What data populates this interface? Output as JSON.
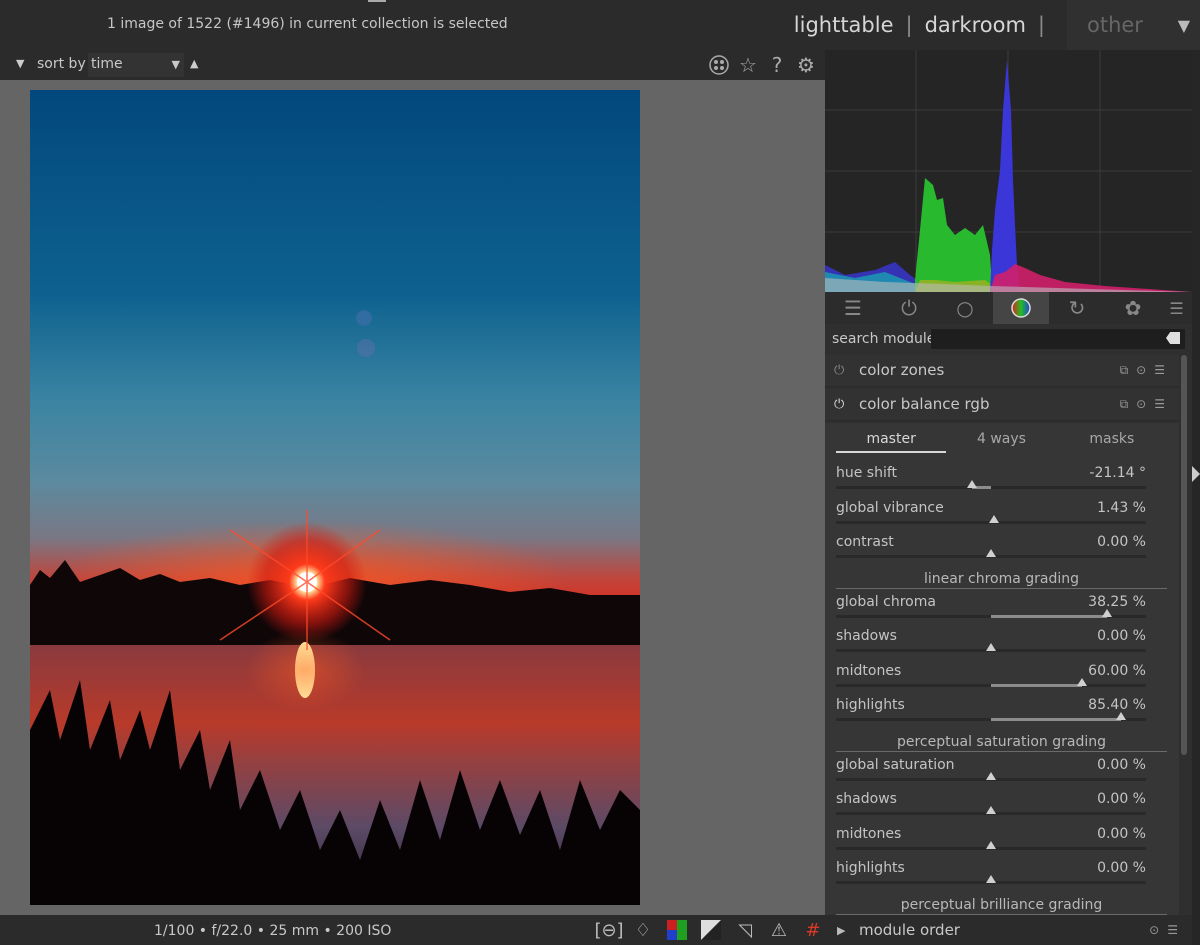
{
  "topbar": {
    "status": "1 image of 1522 (#1496) in current collection is selected",
    "views": {
      "lighttable": "lighttable",
      "darkroom": "darkroom",
      "other": "other",
      "separator": "|"
    }
  },
  "filterbar": {
    "sort_label": "sort by",
    "sort_value": "time",
    "icons": [
      "grouping-icon",
      "star-icon",
      "help-icon",
      "gear-icon"
    ]
  },
  "bottombar": {
    "exif": "1/100 • f/22.0 • 25 mm • 200 ISO",
    "icons": [
      "focus-peaking-icon",
      "bulb-icon",
      "color-assessment-icon",
      "raw-overexposed-icon",
      "clipping-icon",
      "gamut-warning-icon",
      "guides-icon"
    ]
  },
  "histogram": {
    "colors": {
      "red": "#d0206a",
      "green": "#29c12f",
      "blue": "#3a36d8",
      "grid": "#3a3a3a"
    }
  },
  "module_groups": [
    "quick-access-icon",
    "active-modules-icon",
    "base-group-icon",
    "color-group-icon",
    "correct-group-icon",
    "effect-group-icon",
    "presets-menu-icon"
  ],
  "search": {
    "label": "search module",
    "value": ""
  },
  "modules": [
    {
      "name": "color zones",
      "enabled": false
    },
    {
      "name": "color balance rgb",
      "enabled": true
    }
  ],
  "color_balance": {
    "tabs": [
      "master",
      "4 ways",
      "masks"
    ],
    "active_tab": "master",
    "rows": [
      {
        "type": "slider",
        "label": "hue shift",
        "value": "-21.14 °",
        "pos": 0.44,
        "fill": [
          0.44,
          0.5
        ]
      },
      {
        "type": "slider",
        "label": "global vibrance",
        "value": "1.43 %",
        "pos": 0.51,
        "fill": null
      },
      {
        "type": "slider",
        "label": "contrast",
        "value": "0.00 %",
        "pos": 0.5,
        "fill": null
      },
      {
        "type": "section",
        "label": "linear chroma grading"
      },
      {
        "type": "slider",
        "label": "global chroma",
        "value": "38.25 %",
        "pos": 0.875,
        "fill": [
          0.5,
          0.875
        ]
      },
      {
        "type": "slider",
        "label": "shadows",
        "value": "0.00 %",
        "pos": 0.5,
        "fill": null
      },
      {
        "type": "slider",
        "label": "midtones",
        "value": "60.00 %",
        "pos": 0.795,
        "fill": [
          0.5,
          0.795
        ]
      },
      {
        "type": "slider",
        "label": "highlights",
        "value": "85.40 %",
        "pos": 0.92,
        "fill": [
          0.5,
          0.92
        ]
      },
      {
        "type": "section",
        "label": "perceptual saturation grading"
      },
      {
        "type": "slider",
        "label": "global saturation",
        "value": "0.00 %",
        "pos": 0.5,
        "fill": null
      },
      {
        "type": "slider",
        "label": "shadows",
        "value": "0.00 %",
        "pos": 0.5,
        "fill": null
      },
      {
        "type": "slider",
        "label": "midtones",
        "value": "0.00 %",
        "pos": 0.5,
        "fill": null
      },
      {
        "type": "slider",
        "label": "highlights",
        "value": "0.00 %",
        "pos": 0.5,
        "fill": null
      },
      {
        "type": "section",
        "label": "perceptual brilliance grading"
      }
    ]
  },
  "module_order": {
    "label": "module order"
  }
}
